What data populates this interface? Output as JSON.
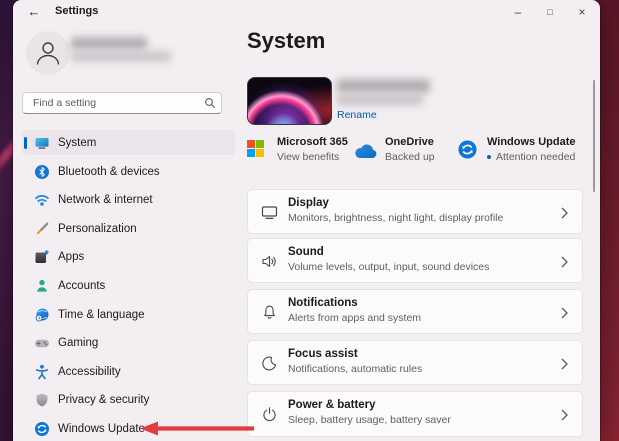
{
  "window": {
    "title": "Settings",
    "back_icon": "←",
    "controls": {
      "minimize": "–",
      "maximize": "□",
      "close": "×"
    }
  },
  "sidebar": {
    "search": {
      "placeholder": "Find a setting"
    },
    "items": [
      {
        "label": "System",
        "icon": "system-monitor",
        "selected": true
      },
      {
        "label": "Bluetooth & devices",
        "icon": "bluetooth"
      },
      {
        "label": "Network & internet",
        "icon": "wifi"
      },
      {
        "label": "Personalization",
        "icon": "paintbrush"
      },
      {
        "label": "Apps",
        "icon": "app-grid"
      },
      {
        "label": "Accounts",
        "icon": "person"
      },
      {
        "label": "Time & language",
        "icon": "globe-clock"
      },
      {
        "label": "Gaming",
        "icon": "gamepad"
      },
      {
        "label": "Accessibility",
        "icon": "accessibility-person"
      },
      {
        "label": "Privacy & security",
        "icon": "shield"
      },
      {
        "label": "Windows Update",
        "icon": "update-sync"
      }
    ]
  },
  "main": {
    "page_title": "System",
    "device": {
      "rename_label": "Rename"
    },
    "status_cards": [
      {
        "title": "Microsoft 365",
        "subtitle": "View benefits",
        "icon": "microsoft-logo"
      },
      {
        "title": "OneDrive",
        "subtitle": "Backed up",
        "icon": "onedrive-cloud"
      },
      {
        "title": "Windows Update",
        "subtitle": "Attention needed",
        "icon": "windows-update",
        "has_alert_dot": true
      }
    ],
    "rows": [
      {
        "title": "Display",
        "subtitle": "Monitors, brightness, night light, display profile",
        "icon": "monitor"
      },
      {
        "title": "Sound",
        "subtitle": "Volume levels, output, input, sound devices",
        "icon": "speaker"
      },
      {
        "title": "Notifications",
        "subtitle": "Alerts from apps and system",
        "icon": "bell"
      },
      {
        "title": "Focus assist",
        "subtitle": "Notifications, automatic rules",
        "icon": "moon"
      },
      {
        "title": "Power & battery",
        "subtitle": "Sleep, battery usage, battery saver",
        "icon": "power"
      }
    ]
  },
  "annotations": {
    "arrow_target": "Windows Update"
  },
  "colors": {
    "accent_blue": "#0067c0",
    "link_blue": "#005aab",
    "alert_dot_blue": "#0b62c4",
    "annotation_arrow_red": "#e13c42",
    "selected_item_bg": "#ebe4ea",
    "window_bg": "#f3eef2",
    "card_bg": "#fcfbfc",
    "ms_logo": [
      "#f25022",
      "#7fba00",
      "#00a4ef",
      "#ffb900"
    ]
  }
}
